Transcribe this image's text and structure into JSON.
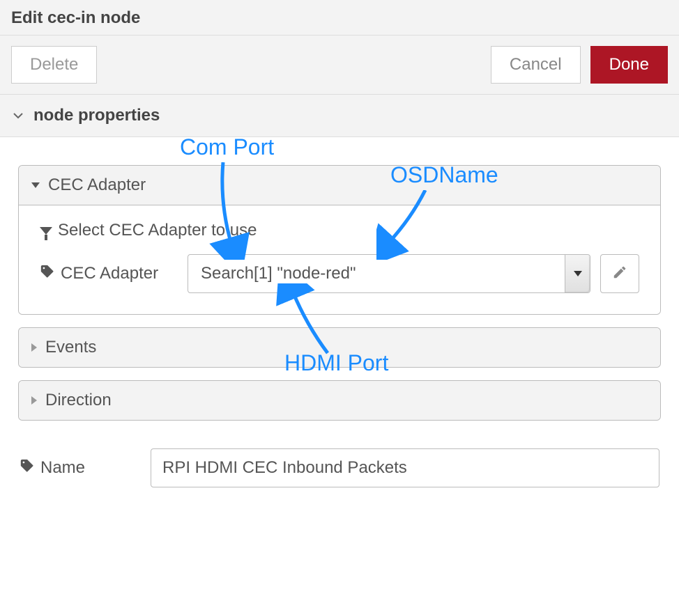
{
  "header": {
    "title": "Edit cec-in node"
  },
  "actions": {
    "delete_label": "Delete",
    "cancel_label": "Cancel",
    "done_label": "Done"
  },
  "section": {
    "title": "node properties"
  },
  "panels": {
    "cec_adapter": {
      "title": "CEC Adapter",
      "help_text": "Select CEC Adapter to use",
      "field_label": "CEC Adapter",
      "selected_value": "Search[1] \"node-red\""
    },
    "events": {
      "title": "Events"
    },
    "direction": {
      "title": "Direction"
    }
  },
  "name_field": {
    "label": "Name",
    "value": "RPI HDMI CEC Inbound Packets"
  },
  "annotations": {
    "com_port": "Com Port",
    "osd_name": "OSDName",
    "hdmi_port": "HDMI Port"
  }
}
